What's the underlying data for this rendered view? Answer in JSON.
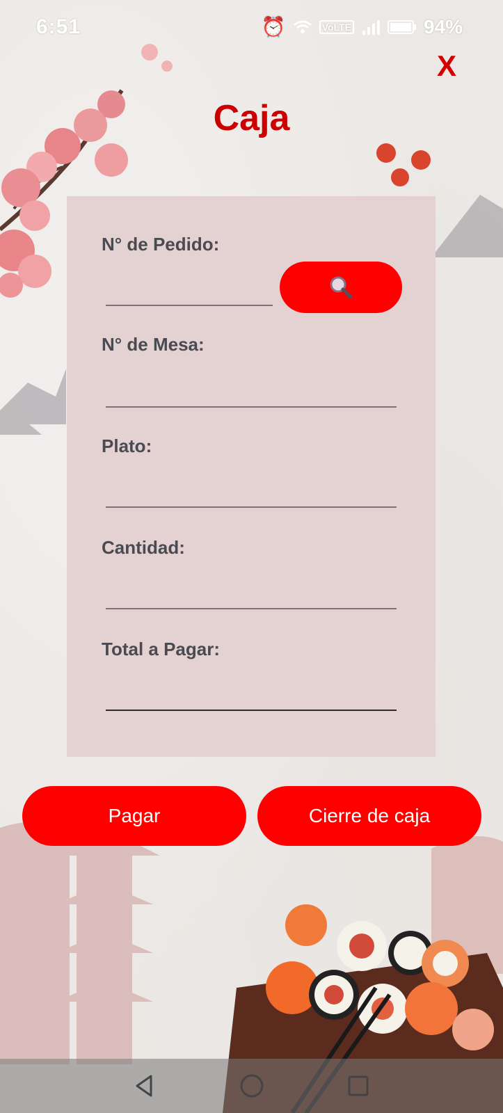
{
  "status_bar": {
    "time": "6:51",
    "battery": "94%",
    "network_label": "VoLTE"
  },
  "header": {
    "close_label": "X",
    "title": "Caja"
  },
  "form": {
    "fields": [
      {
        "label": "N° de Pedido:",
        "value": ""
      },
      {
        "label": "N° de Mesa:",
        "value": ""
      },
      {
        "label": "Plato:",
        "value": ""
      },
      {
        "label": "Cantidad:",
        "value": ""
      },
      {
        "label": "Total a Pagar:",
        "value": ""
      }
    ],
    "search_icon": "magnifier-icon"
  },
  "actions": {
    "pay_label": "Pagar",
    "close_register_label": "Cierre de caja"
  },
  "colors": {
    "accent": "#ff0000",
    "title": "#cc0000",
    "panel": "#e4d1d1",
    "label": "#4a4a52"
  },
  "nav": {
    "back_icon": "back-triangle-icon",
    "home_icon": "home-circle-icon",
    "recents_icon": "recents-square-icon"
  }
}
